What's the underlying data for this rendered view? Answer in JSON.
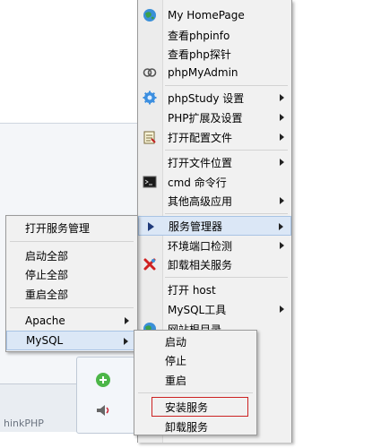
{
  "background": {
    "partial_text": "hinkPHP"
  },
  "main_menu": {
    "items": [
      {
        "label": "My HomePage",
        "icon": "globe-icon",
        "submenu": false
      },
      {
        "label": "查看phpinfo",
        "icon": "",
        "submenu": false
      },
      {
        "label": "查看php探针",
        "icon": "",
        "submenu": false
      },
      {
        "label": "phpMyAdmin",
        "icon": "rings-icon",
        "submenu": false
      },
      {
        "label": "phpStudy 设置",
        "icon": "gear-icon",
        "submenu": true
      },
      {
        "label": "PHP扩展及设置",
        "icon": "",
        "submenu": true
      },
      {
        "label": "打开配置文件",
        "icon": "notepad-icon",
        "submenu": true
      },
      {
        "label": "打开文件位置",
        "icon": "",
        "submenu": true
      },
      {
        "label": "cmd 命令行",
        "icon": "terminal-icon",
        "submenu": false
      },
      {
        "label": "其他高级应用",
        "icon": "",
        "submenu": true
      },
      {
        "label": "服务管理器",
        "icon": "play-icon",
        "submenu": true
      },
      {
        "label": "环境端口检测",
        "icon": "",
        "submenu": true
      },
      {
        "label": "卸载相关服务",
        "icon": "red-x-icon",
        "submenu": false
      },
      {
        "label": "打开 host",
        "icon": "",
        "submenu": false
      },
      {
        "label": "MySQL工具",
        "icon": "",
        "submenu": true
      },
      {
        "label": "网站根目录",
        "icon": "globe-icon",
        "submenu": false
      }
    ]
  },
  "left_menu": {
    "items": [
      {
        "label": "打开服务管理",
        "submenu": false
      },
      {
        "label": "启动全部",
        "submenu": false
      },
      {
        "label": "停止全部",
        "submenu": false
      },
      {
        "label": "重启全部",
        "submenu": false
      },
      {
        "label": "Apache",
        "submenu": true
      },
      {
        "label": "MySQL",
        "submenu": true
      }
    ]
  },
  "sub_menu": {
    "items": [
      {
        "label": "启动"
      },
      {
        "label": "停止"
      },
      {
        "label": "重启"
      },
      {
        "label": "安装服务",
        "highlighted_box": true
      },
      {
        "label": "卸载服务"
      }
    ]
  },
  "colors": {
    "highlight_box": "#cc2222",
    "menu_bg": "#f1f1f1",
    "hover_bg": "#dbe7f6"
  }
}
